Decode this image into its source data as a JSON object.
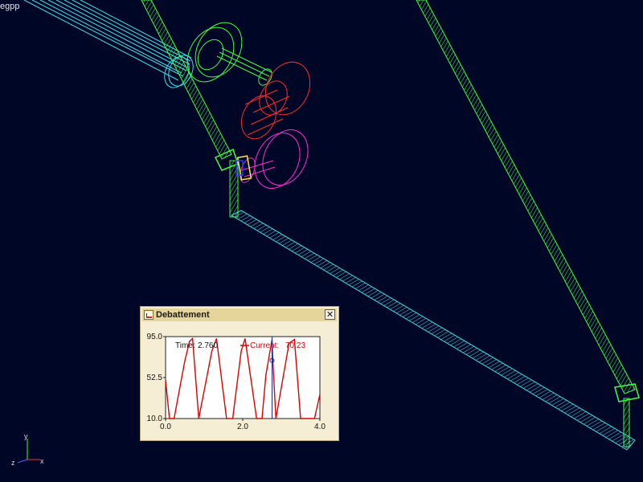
{
  "model_name": "egpp",
  "axes_triad": {
    "y": "y",
    "x": "x",
    "z": "z"
  },
  "colors": {
    "background": "#000626",
    "green_links": "#3dff3d",
    "cyan_links": "#38e0e8",
    "gear_green": "#3dff3d",
    "gear_red": "#ff2a2a",
    "gear_magenta": "#ff2ad4",
    "joint_yellow": "#ffe63d",
    "joint_blue": "#2a3cff"
  },
  "plot_window": {
    "title": "Debattement",
    "close_label": "✕",
    "readout": {
      "time_label": "Time:",
      "time_value": "2.760",
      "current_label": "Current:",
      "current_value": "70.23"
    },
    "marker_time": 2.76
  },
  "chart_data": {
    "type": "line",
    "title": "Debattement",
    "xlabel": "",
    "ylabel": "",
    "xlim": [
      0.0,
      4.0
    ],
    "ylim": [
      10.0,
      95.0
    ],
    "x_tick_labels": [
      "0.0",
      "2.0",
      "4.0"
    ],
    "y_tick_labels": [
      "95.0",
      "52.5",
      "10.0"
    ],
    "grid": false,
    "series": [
      {
        "color": "#e00000",
        "x": [
          0.0,
          0.1,
          0.22,
          0.5,
          0.62,
          0.7,
          0.86,
          1.2,
          1.32,
          1.58,
          1.74,
          1.96,
          2.06,
          2.36,
          2.5,
          2.6,
          2.76,
          2.78,
          2.86,
          3.2,
          3.34,
          3.5,
          3.7,
          3.86,
          4.0
        ],
        "y": [
          50,
          10,
          10,
          70,
          90,
          93,
          10,
          80,
          93,
          10,
          10,
          80,
          93,
          10,
          10,
          55,
          92,
          70,
          10,
          88,
          92,
          10,
          10,
          10,
          35
        ]
      }
    ]
  }
}
